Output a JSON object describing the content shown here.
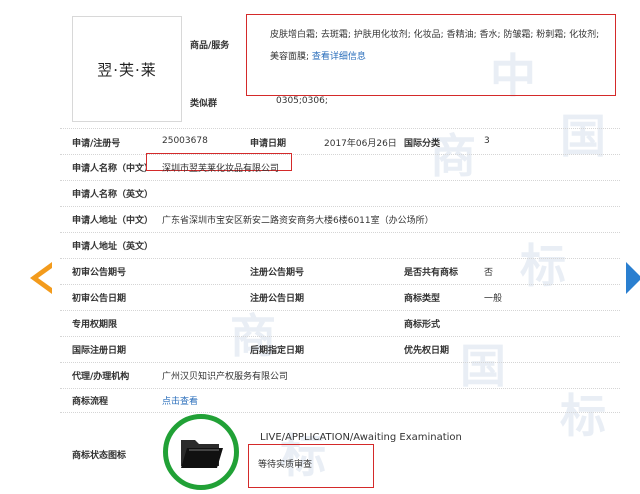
{
  "logo": {
    "text": "翌·芙·莱"
  },
  "goods": {
    "label": "商品/服务",
    "text": "皮肤增白霜; 去斑霜; 护肤用化妆剂; 化妆品; 香精油; 香水; 防皱霜; 粉刺霜; 化妆剂; 美容面膜;",
    "link": "查看详细信息"
  },
  "similar_group": {
    "label": "类似群",
    "value": "0305;0306;"
  },
  "reg_no": {
    "label": "申请/注册号",
    "value": "25003678"
  },
  "app_date": {
    "label": "申请日期",
    "value": "2017年06月26日"
  },
  "intl_class": {
    "label": "国际分类",
    "value": "3"
  },
  "applicant_cn": {
    "label": "申请人名称（中文）",
    "value": "深圳市翌芙莱化妆品有限公司"
  },
  "applicant_en": {
    "label": "申请人名称（英文）",
    "value": ""
  },
  "address_cn": {
    "label": "申请人地址（中文）",
    "value": "广东省深圳市宝安区新安二路资安商务大楼6楼6011室（办公场所）"
  },
  "address_en": {
    "label": "申请人地址（英文）",
    "value": ""
  },
  "prelim_no": {
    "label": "初审公告期号",
    "value": ""
  },
  "reg_pub_no": {
    "label": "注册公告期号",
    "value": ""
  },
  "shared": {
    "label": "是否共有商标",
    "value": "否"
  },
  "prelim_date": {
    "label": "初审公告日期",
    "value": ""
  },
  "reg_pub_date": {
    "label": "注册公告日期",
    "value": ""
  },
  "tm_type": {
    "label": "商标类型",
    "value": "一般"
  },
  "exclusive_period": {
    "label": "专用权期限",
    "value": ""
  },
  "tm_form": {
    "label": "商标形式",
    "value": ""
  },
  "intl_reg_date": {
    "label": "国际注册日期",
    "value": ""
  },
  "later_date": {
    "label": "后期指定日期",
    "value": ""
  },
  "priority_date": {
    "label": "优先权日期",
    "value": ""
  },
  "agent": {
    "label": "代理/办理机构",
    "value": "广州汉贝知识产权服务有限公司"
  },
  "process": {
    "label": "商标流程",
    "link": "点击查看"
  },
  "status": {
    "label": "商标状态图标",
    "en": "LIVE/APPLICATION/Awaiting Examination",
    "cn": "等待实质审查"
  },
  "watermark": [
    "中",
    "国",
    "商",
    "标",
    "国",
    "标",
    "商",
    "标"
  ],
  "colors": {
    "highlight": "#d42a2a",
    "link": "#2a6ebb",
    "prev": "#f39b1c",
    "next": "#2a7fd0",
    "status_ring": "#21a136"
  }
}
